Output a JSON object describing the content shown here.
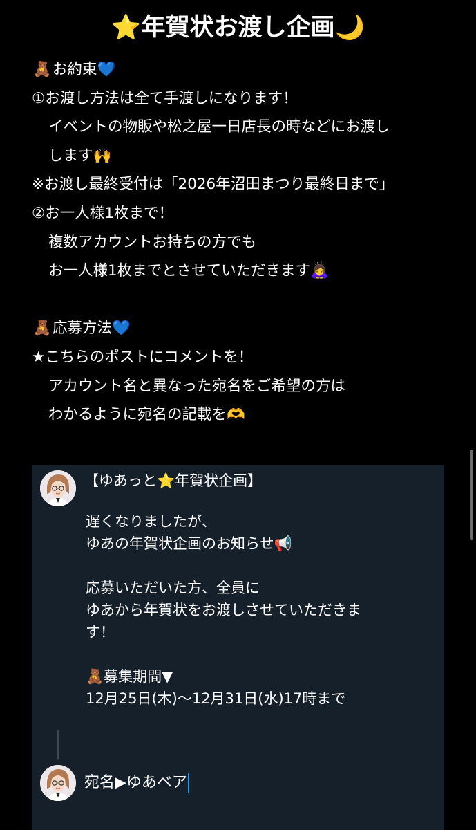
{
  "title": "⭐️年賀状お渡し企画🌙",
  "rules": {
    "promise_heading": "お約束",
    "promise_icon": "teddy-bear",
    "promise_heart": "💙",
    "item1": "①お渡し方法は全て手渡しになります！",
    "item1_detail1": "イベントの物販や松之屋一日店長の時などにお渡し",
    "item1_detail2": "します🙌",
    "note": "※お渡し最終受付は「2026年沼田まつり最終日まで」",
    "item2": "②お一人様1枚まで！",
    "item2_detail1": "複数アカウントお持ちの方でも",
    "item2_detail2": "お一人様1枚までとさせていただきます🙇‍♀️",
    "apply_heading": "応募方法",
    "apply_heart": "💙",
    "apply1": "★こちらのポストにコメントを！",
    "apply1_detail1": "アカウント名と異なった宛名をご希望の方は",
    "apply1_detail2": "わかるように宛名の記載を🫶"
  },
  "embedded_post": {
    "title": "【ゆあっと⭐️年賀状企画】",
    "line1": "遅くなりましたが、",
    "line2": "ゆあの年賀状企画のお知らせ📢",
    "line3": "応募いただいた方、全員に",
    "line4": "ゆあから年賀状をお渡しさせていただきま",
    "line5": "す！",
    "period_heading": "🧸募集期間▼",
    "period_value": "12月25日(木)〜12月31日(水)17時まで"
  },
  "reply": {
    "text": "宛名▶︎ゆあベア"
  },
  "colors": {
    "background": "#000000",
    "card_background": "#15202b",
    "text": "#ffffff",
    "caret": "#1d9bf0"
  }
}
